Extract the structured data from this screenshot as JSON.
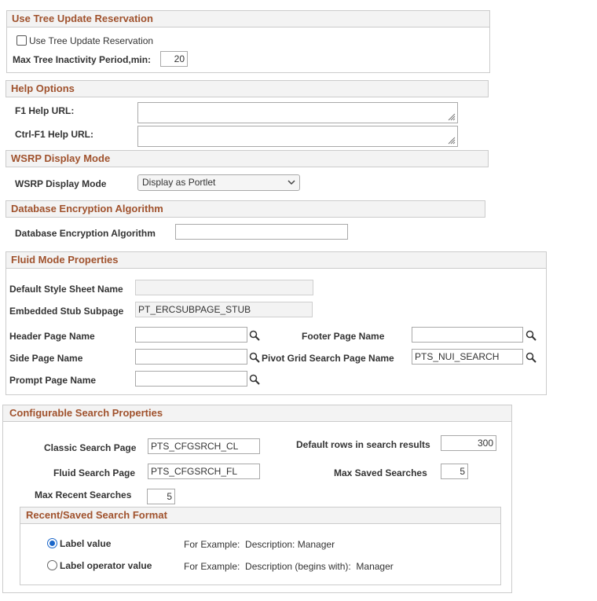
{
  "tree_update": {
    "header": "Use Tree Update Reservation",
    "checkbox_label": "Use Tree Update Reservation",
    "checked": false,
    "max_inactivity_label": "Max Tree Inactivity Period,min:",
    "max_inactivity_value": "20"
  },
  "help_options": {
    "header": "Help Options",
    "f1_label": "F1 Help URL:",
    "f1_value": "",
    "ctrl_f1_label": "Ctrl-F1 Help URL:",
    "ctrl_f1_value": ""
  },
  "wsrp": {
    "header": "WSRP Display Mode",
    "label": "WSRP Display Mode",
    "selected": "Display as Portlet"
  },
  "encryption": {
    "header": "Database Encryption Algorithm",
    "label": "Database Encryption Algorithm",
    "value": ""
  },
  "fluid": {
    "header": "Fluid Mode Properties",
    "default_style_label": "Default Style Sheet Name",
    "default_style_value": "",
    "stub_label": "Embedded Stub Subpage",
    "stub_value": "PT_ERCSUBPAGE_STUB",
    "header_page_label": "Header Page Name",
    "header_page_value": "",
    "footer_page_label": "Footer Page Name",
    "footer_page_value": "",
    "side_page_label": "Side Page Name",
    "side_page_value": "",
    "pivot_label": "Pivot Grid Search Page Name",
    "pivot_value": "PTS_NUI_SEARCH",
    "prompt_page_label": "Prompt Page Name",
    "prompt_page_value": ""
  },
  "search": {
    "header": "Configurable Search Properties",
    "classic_label": "Classic Search Page",
    "classic_value": "PTS_CFGSRCH_CL",
    "default_rows_label": "Default rows in search results",
    "default_rows_value": "300",
    "fluid_label": "Fluid Search Page",
    "fluid_value": "PTS_CFGSRCH_FL",
    "max_saved_label": "Max Saved Searches",
    "max_saved_value": "5",
    "max_recent_label": "Max Recent Searches",
    "max_recent_value": "5",
    "format": {
      "header": "Recent/Saved Search Format",
      "option1_label": "Label value",
      "option1_example": "For Example:  Description: Manager",
      "option2_label": "Label operator value",
      "option2_example": "For Example:  Description (begins with):  Manager",
      "selected": "Label value"
    }
  },
  "colors": {
    "section_header_text": "#a0522d",
    "radio_selected": "#1a66c9"
  }
}
